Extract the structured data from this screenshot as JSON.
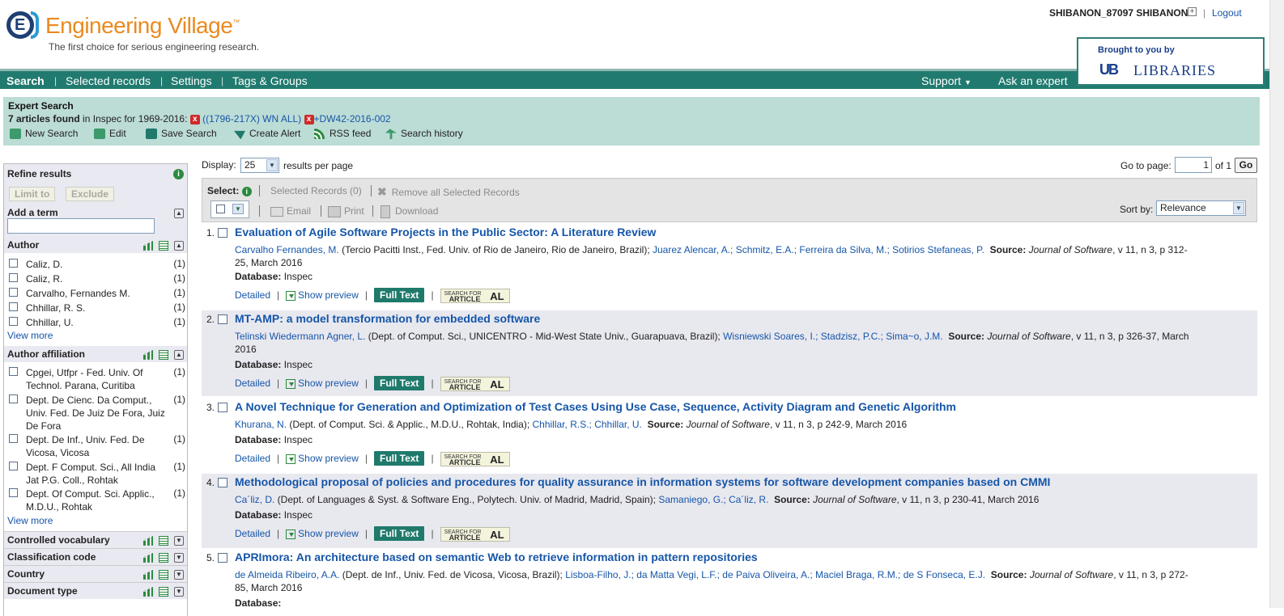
{
  "header": {
    "brand": "Engineering Village",
    "trademark": "™",
    "tagline": "The first choice for serious engineering research.",
    "user": "SHIBANON_87097 SHIBANON",
    "logout": "Logout",
    "brought_by": "Brought to you by",
    "ub_logo": "UB",
    "ub_libraries": "LIBRARIES"
  },
  "nav": {
    "search": "Search",
    "selected_records": "Selected records",
    "settings": "Settings",
    "tags_groups": "Tags & Groups",
    "support": "Support",
    "ask_expert": "Ask an expert"
  },
  "expert": {
    "title": "Expert Search",
    "count": "7 articles found",
    "in_text": " in Inspec for 1969-2016: ",
    "query1": "((1796-217X) WN ALL)",
    "query2": "+DW42-2016-002",
    "tools": {
      "new_search": "New Search",
      "edit": "Edit",
      "save_search": "Save Search",
      "create_alert": "Create Alert",
      "rss": "RSS feed",
      "history": "Search history"
    }
  },
  "sidebar": {
    "refine": "Refine results",
    "limit_to": "Limit to",
    "exclude": "Exclude",
    "add_term": "Add a term",
    "author": {
      "title": "Author",
      "items": [
        {
          "label": "Caliz, D.",
          "count": "(1)"
        },
        {
          "label": "Caliz, R.",
          "count": "(1)"
        },
        {
          "label": "Carvalho, Fernandes M.",
          "count": "(1)"
        },
        {
          "label": "Chhillar, R. S.",
          "count": "(1)"
        },
        {
          "label": "Chhillar, U.",
          "count": "(1)"
        }
      ],
      "view_more": "View more"
    },
    "affiliation": {
      "title": "Author affiliation",
      "items": [
        {
          "label": "Cpgei, Utfpr - Fed. Univ. Of Technol. Parana, Curitiba",
          "count": "(1)"
        },
        {
          "label": "Dept. De Cienc. Da Comput., Univ. Fed. De Juiz De Fora, Juiz De Fora",
          "count": "(1)"
        },
        {
          "label": "Dept. De Inf., Univ. Fed. De Vicosa, Vicosa",
          "count": "(1)"
        },
        {
          "label": "Dept. F Comput. Sci., All India Jat P.G. Coll., Rohtak",
          "count": "(1)"
        },
        {
          "label": "Dept. Of Comput. Sci. Applic., M.D.U., Rohtak",
          "count": "(1)"
        }
      ],
      "view_more": "View more"
    },
    "collapsed": [
      "Controlled vocabulary",
      "Classification code",
      "Country",
      "Document type"
    ]
  },
  "display": {
    "label": "Display:",
    "value": "25",
    "suffix": "results per page",
    "goto_label": "Go to page:",
    "page": "1",
    "of_pages": "of 1",
    "go": "Go"
  },
  "toolbar": {
    "select": "Select:",
    "selected_records": "Selected Records (0)",
    "remove_all": "Remove all Selected Records",
    "email": "Email",
    "print": "Print",
    "download": "Download",
    "sort_by": "Sort by:",
    "sort_value": "Relevance"
  },
  "result_actions": {
    "detailed": "Detailed",
    "show_preview": "Show preview",
    "full_text": "Full Text",
    "sfa_line1": "SEARCH FOR",
    "sfa_line2": "ARTICLE",
    "sfa_al": "AL",
    "database_label": "Database:",
    "database_value": "Inspec",
    "source_label": "Source:"
  },
  "results": [
    {
      "num": "1.",
      "title": "Evaluation of Agile Software Projects in the Public Sector: A Literature Review",
      "a1": "Carvalho Fernandes, M.",
      "aff": " (Tercio Pacitti Inst., Fed. Univ. of Rio de Janeiro, Rio de Janeiro, Brazil); ",
      "others": "Juarez Alencar, A.; Schmitz, E.A.; Ferreira da Silva, M.; Sotirios Stefaneas, P.",
      "journal": "Journal of Software",
      "details": ", v 11, n 3, p 312-25, March 2016"
    },
    {
      "num": "2.",
      "title": "MT-AMP: a model transformation for embedded software",
      "a1": "Telinski Wiedermann Agner, L.",
      "aff": " (Dept. of Comput. Sci., UNICENTRO - Mid-West State Univ., Guarapuava, Brazil); ",
      "others": "Wisniewski Soares, I.; Stadzisz, P.C.; Sima~o, J.M.",
      "journal": "Journal of Software",
      "details": ", v 11, n 3, p 326-37, March 2016"
    },
    {
      "num": "3.",
      "title": "A Novel Technique for Generation and Optimization of Test Cases Using Use Case, Sequence, Activity Diagram and Genetic Algorithm",
      "a1": "Khurana, N.",
      "aff": " (Dept. of Comput. Sci. & Applic., M.D.U., Rohtak, India); ",
      "others": "Chhillar, R.S.; Chhillar, U.",
      "journal": "Journal of Software",
      "details": ", v 11, n 3, p 242-9, March 2016"
    },
    {
      "num": "4.",
      "title": "Methodological proposal of policies and procedures for quality assurance in information systems for software development companies based on CMMI",
      "a1": "Ca´liz, D.",
      "aff": " (Dept. of Languages & Syst. & Software Eng., Polytech. Univ. of Madrid, Madrid, Spain); ",
      "others": "Samaniego, G.; Ca´liz, R.",
      "journal": "Journal of Software",
      "details": ", v 11, n 3, p 230-41, March 2016"
    },
    {
      "num": "5.",
      "title": "APRImora: An architecture based on semantic Web to retrieve information in pattern repositories",
      "a1": "de Almeida Ribeiro, A.A.",
      "aff": " (Dept. de Inf., Univ. Fed. de Vicosa, Vicosa, Brazil); ",
      "others": "Lisboa-Filho, J.; da Matta Vegi, L.F.; de Paiva Oliveira, A.; Maciel Braga, R.M.; de S Fonseca, E.J.",
      "journal": "Journal of Software",
      "details": ", v 11, n 3, p 272-85, March 2016"
    }
  ]
}
